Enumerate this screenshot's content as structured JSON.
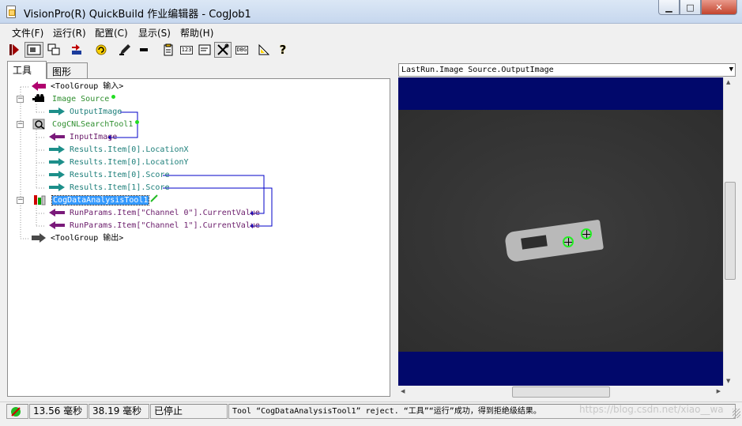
{
  "window": {
    "title": "VisionPro(R) QuickBuild 作业编辑器 - CogJob1",
    "minimize_glyph": "▁",
    "maximize_glyph": "□",
    "close_glyph": "✕"
  },
  "menu": [
    "文件(F)",
    "运行(R)",
    "配置(C)",
    "显示(S)",
    "帮助(H)"
  ],
  "toolbar": {
    "icons": [
      "run-icon",
      "run-continuous-icon",
      "image-display-icon",
      "reset-icon",
      "refresh-icon",
      "pen-icon",
      "record-icon",
      "notepad-icon",
      "numeric-display-icon",
      "terminal-icon",
      "tools-icon",
      "debug-icon",
      "ruler-icon",
      "help-icon"
    ],
    "label_123": "123",
    "label_dbg": "DBG",
    "help_glyph": "?"
  },
  "tabs": {
    "tools": "工具",
    "graphics": "图形"
  },
  "tree": {
    "rows": [
      "<ToolGroup 输入>",
      "Image Source",
      "OutputImage",
      "CogCNLSearchTool1",
      "InputImage",
      "Results.Item[0].LocationX",
      "Results.Item[0].LocationY",
      "Results.Item[0].Score",
      "Results.Item[1].Score",
      "CogDataAnalysisTool1",
      "RunParams.Item[\"Channel 0\"].CurrentValue",
      "RunParams.Item[\"Channel 1\"].CurrentValue",
      "<ToolGroup 输出>"
    ]
  },
  "image_panel": {
    "source": "LastRun.Image Source.OutputImage"
  },
  "status": {
    "time1": "13.56 毫秒",
    "time2": "38.19 毫秒",
    "state": "已停止",
    "message": "Tool “CogDataAnalysisTool1” reject. “工具”“运行”成功，得到拒绝级结果。"
  },
  "watermark": "https://blog.csdn.net/xiao__wa",
  "colors": {
    "link_line": "#0000c8",
    "image_background": "#01086b",
    "selection": "#3399ff"
  }
}
